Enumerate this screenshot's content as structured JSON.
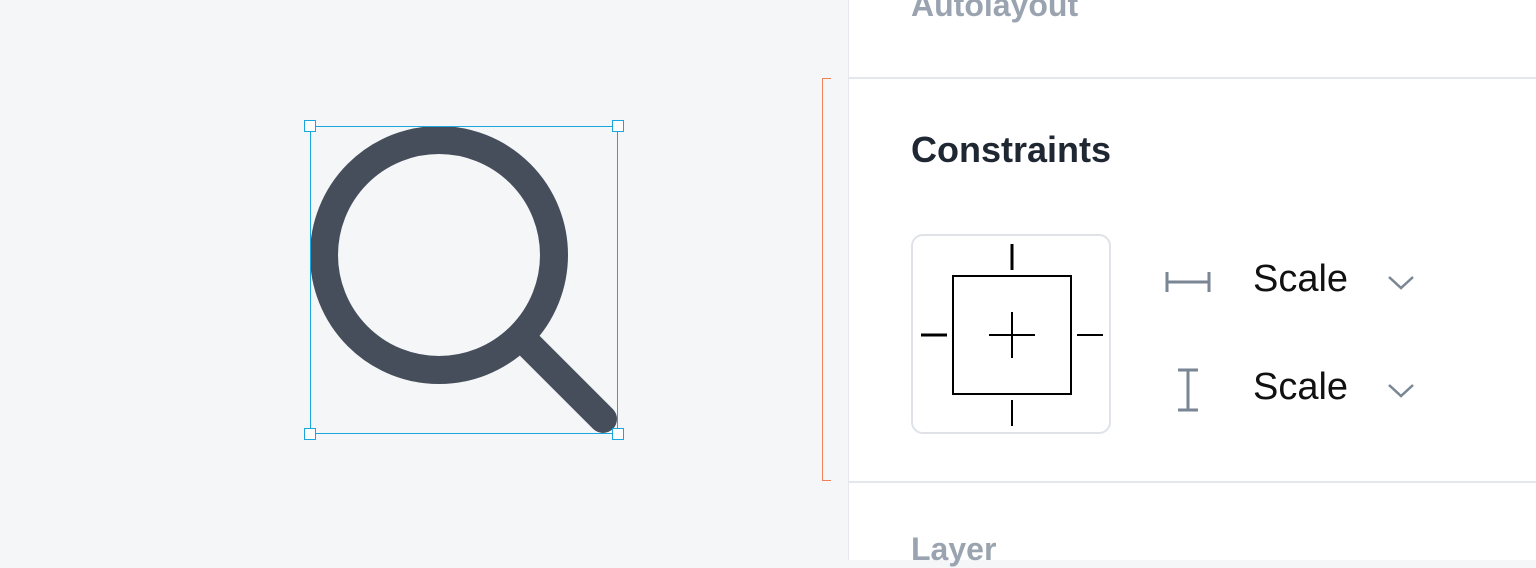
{
  "colors": {
    "canvas_bg": "#f4f6f8",
    "selection": "#1aa7e0",
    "icon_stroke": "#454e5a",
    "bracket": "#f0825a",
    "panel_bg": "#ffffff",
    "muted_text": "#9aa4b0",
    "heading_text": "#1f2733",
    "axis_icon": "#7a8694"
  },
  "canvas": {
    "selected_icon": "search-icon"
  },
  "panel": {
    "autolayout": {
      "title": "Autolayout"
    },
    "constraints": {
      "title": "Constraints",
      "horizontal": {
        "icon": "horizontal-constraint-icon",
        "value": "Scale"
      },
      "vertical": {
        "icon": "vertical-constraint-icon",
        "value": "Scale"
      }
    },
    "layer": {
      "title": "Layer"
    }
  }
}
